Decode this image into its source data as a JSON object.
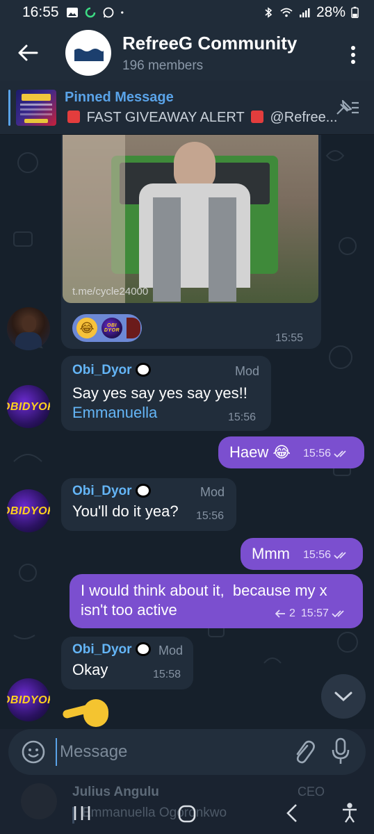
{
  "status": {
    "time": "16:55",
    "battery": "28%"
  },
  "header": {
    "title": "RefreeG Community",
    "subtitle": "196 members"
  },
  "pinned": {
    "title": "Pinned Message",
    "text": "FAST GIVEAWAY ALERT",
    "mention": "@Refree..."
  },
  "media": {
    "caption": "t.me/cycle24000",
    "time": "15:55",
    "reactions": [
      "laughing-emoji",
      "obi-dyor-sticker",
      "red-avatar"
    ]
  },
  "messages": [
    {
      "sender": "Obi_Dyor",
      "role": "Mod",
      "text": "Say yes say yes say yes!!",
      "mention": "Emmanuella",
      "time": "15:56"
    },
    {
      "out": true,
      "text": "Haew 😂",
      "time": "15:56"
    },
    {
      "sender": "Obi_Dyor",
      "role": "Mod",
      "text": "You'll do it yea?",
      "time": "15:56"
    },
    {
      "out": true,
      "text": "Mmm",
      "time": "15:56"
    },
    {
      "out": true,
      "line1": "I would think about it,  because my x",
      "line2": "isn't too active",
      "reply_count": "2",
      "time": "15:57"
    },
    {
      "sender": "Obi_Dyor",
      "role": "Mod",
      "text": "Okay",
      "time": "15:58"
    }
  ],
  "avatar_text": {
    "line1": "OBI",
    "line2": "DYOR"
  },
  "input": {
    "placeholder": "Message"
  },
  "under": {
    "name": "Julius Angulu",
    "role": "CEO",
    "sub": "Emmanuella Ogoronkwo"
  },
  "colors": {
    "accent": "#5aa3e8",
    "outgoing": "#7b4fcf",
    "incoming": "#212d3b"
  }
}
